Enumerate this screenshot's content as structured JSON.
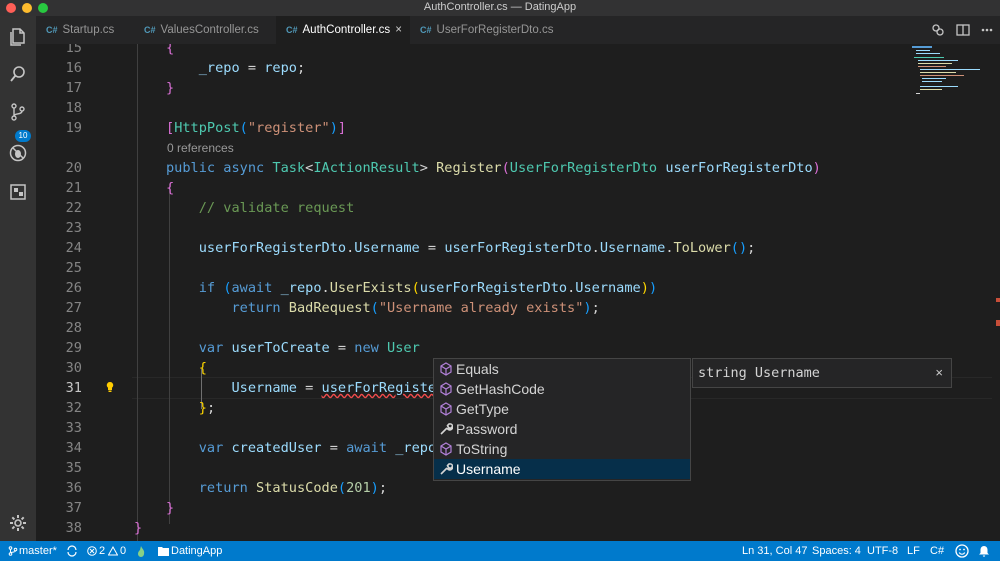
{
  "window": {
    "title": "AuthController.cs — DatingApp"
  },
  "activity_bar": {
    "items": [
      "explorer-icon",
      "search-icon",
      "source-control-icon",
      "debug-icon",
      "extensions-icon"
    ],
    "source_control_badge": "10",
    "settings": "gear-icon"
  },
  "tabs": [
    {
      "icon": "C#",
      "label": "Startup.cs",
      "active": false
    },
    {
      "icon": "C#",
      "label": "ValuesController.cs",
      "active": false
    },
    {
      "icon": "C#",
      "label": "AuthController.cs",
      "active": true,
      "close": "×"
    },
    {
      "icon": "C#",
      "label": "UserForRegisterDto.cs",
      "active": false
    }
  ],
  "editor": {
    "line_numbers": [
      "15",
      "16",
      "17",
      "18",
      "19",
      "20",
      "21",
      "22",
      "23",
      "24",
      "25",
      "26",
      "27",
      "28",
      "29",
      "30",
      "31",
      "32",
      "33",
      "34",
      "35",
      "36",
      "37",
      "38"
    ],
    "codelens": "0 references",
    "current_line": "31"
  },
  "suggest": {
    "items": [
      {
        "label": "Equals",
        "kind": "method"
      },
      {
        "label": "GetHashCode",
        "kind": "method"
      },
      {
        "label": "GetType",
        "kind": "method"
      },
      {
        "label": "Password",
        "kind": "property"
      },
      {
        "label": "ToString",
        "kind": "method"
      },
      {
        "label": "Username",
        "kind": "property",
        "selected": true
      }
    ],
    "detail": "string Username",
    "detail_close": "×"
  },
  "status_bar": {
    "branch": "master*",
    "errors": "2",
    "warnings": "0",
    "folder": "DatingApp",
    "cursor": "Ln 31, Col 47",
    "spaces": "Spaces: 4",
    "encoding": "UTF-8",
    "eol": "LF",
    "language": "C#"
  },
  "colors": {
    "accent": "#007acc",
    "editor_bg": "#1e1e1e",
    "keyword": "#569cd6",
    "type": "#4ec9b0",
    "string": "#ce9178"
  }
}
